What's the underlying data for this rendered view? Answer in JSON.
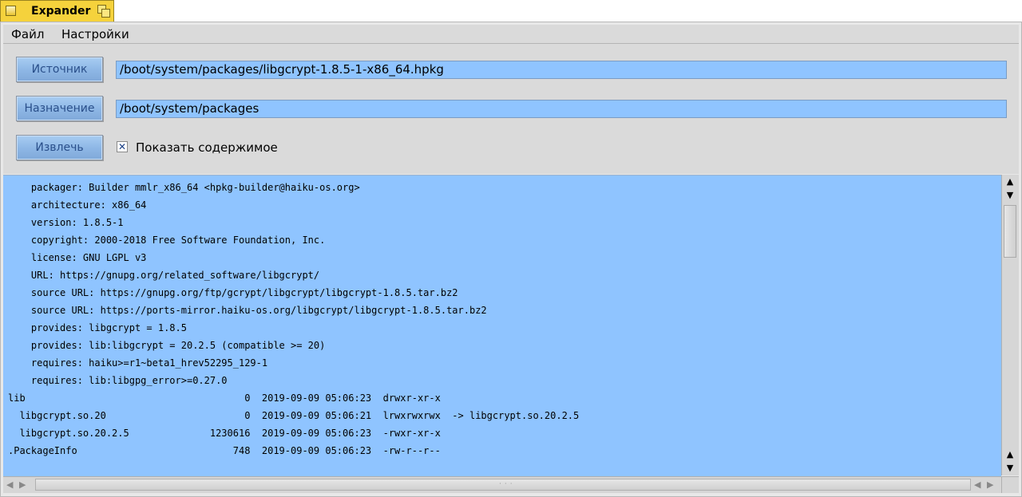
{
  "window": {
    "title": "Expander"
  },
  "menubar": {
    "file": "Файл",
    "settings": "Настройки"
  },
  "source": {
    "button": "Источник",
    "path": "/boot/system/packages/libgcrypt-1.8.5-1-x86_64.hpkg"
  },
  "destination": {
    "button": "Назначение",
    "path": "/boot/system/packages"
  },
  "extract": {
    "button": "Извлечь"
  },
  "show_contents": {
    "label": "Показать содержимое",
    "checked": true,
    "mark": "✕"
  },
  "content": {
    "lines": [
      "    packager: Builder mmlr_x86_64 <hpkg-builder@haiku-os.org>",
      "    architecture: x86_64",
      "    version: 1.8.5-1",
      "    copyright: 2000-2018 Free Software Foundation, Inc.",
      "    license: GNU LGPL v3",
      "    URL: https://gnupg.org/related_software/libgcrypt/",
      "    source URL: https://gnupg.org/ftp/gcrypt/libgcrypt/libgcrypt-1.8.5.tar.bz2",
      "    source URL: https://ports-mirror.haiku-os.org/libgcrypt/libgcrypt-1.8.5.tar.bz2",
      "    provides: libgcrypt = 1.8.5",
      "    provides: lib:libgcrypt = 20.2.5 (compatible >= 20)",
      "    requires: haiku>=r1~beta1_hrev52295_129-1",
      "    requires: lib:libgpg_error>=0.27.0",
      "lib                                      0  2019-09-09 05:06:23  drwxr-xr-x",
      "  libgcrypt.so.20                        0  2019-09-09 05:06:21  lrwxrwxrwx  -> libgcrypt.so.20.2.5",
      "  libgcrypt.so.20.2.5              1230616  2019-09-09 05:06:23  -rwxr-xr-x",
      ".PackageInfo                           748  2019-09-09 05:06:23  -rw-r--r--"
    ]
  },
  "scrollbars": {
    "up_arrow": "▲",
    "down_arrow": "▼",
    "left_arrow": "◀",
    "right_arrow": "▶"
  }
}
